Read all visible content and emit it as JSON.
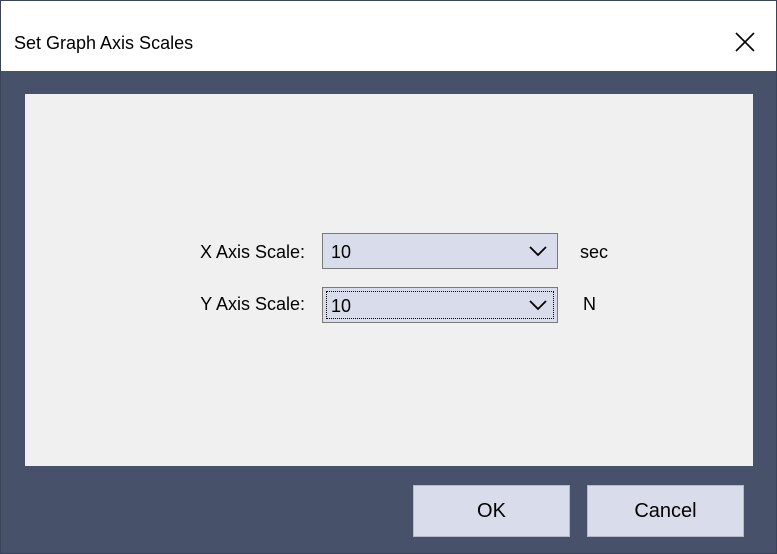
{
  "window": {
    "title": "Set Graph Axis Scales",
    "close_icon": "close-icon"
  },
  "form": {
    "x_axis": {
      "label": "X Axis Scale:",
      "value": "10",
      "unit": "sec"
    },
    "y_axis": {
      "label": "Y Axis Scale:",
      "value": "10",
      "unit": "N"
    }
  },
  "buttons": {
    "ok": "OK",
    "cancel": "Cancel"
  },
  "colors": {
    "frame": "#475169",
    "panel": "#f0f0f0",
    "control": "#d9dceb"
  }
}
